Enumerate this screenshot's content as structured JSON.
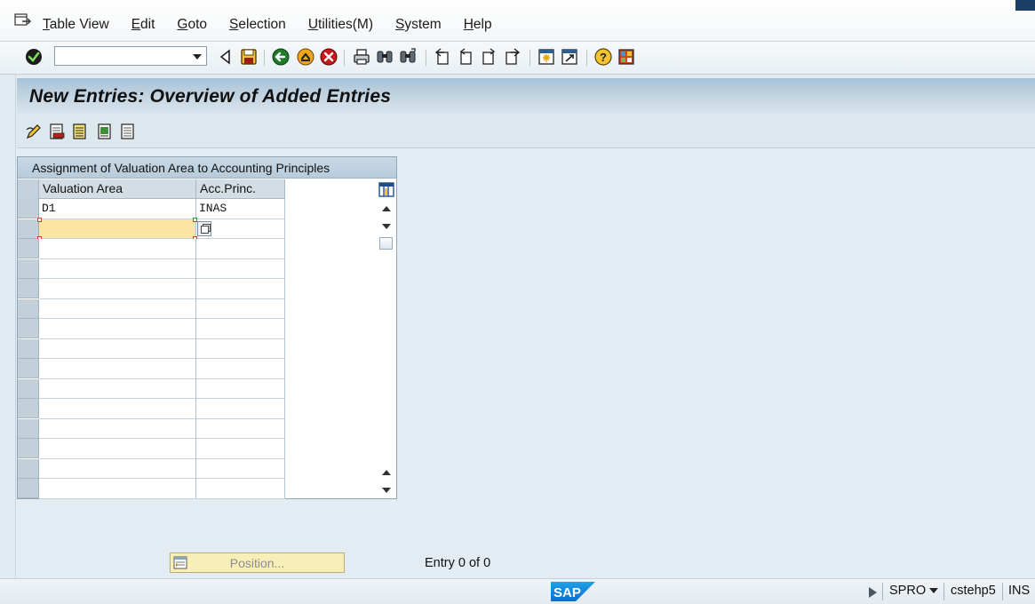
{
  "menubar": {
    "items": [
      "Table View",
      "Edit",
      "Goto",
      "Selection",
      "Utilities(M)",
      "System",
      "Help"
    ]
  },
  "toolbar": {
    "command_value": "",
    "icons": [
      "enter-icon",
      "back-nav-icon",
      "save-icon",
      "back-icon",
      "exit-icon",
      "cancel-icon",
      "print-icon",
      "find-icon",
      "find-next-icon",
      "first-page-icon",
      "previous-page-icon",
      "next-page-icon",
      "last-page-icon",
      "create-session-icon",
      "create-shortcut-icon",
      "help-icon",
      "customize-layout-icon"
    ]
  },
  "title": "New Entries: Overview of Added Entries",
  "app_toolbar": {
    "icons": [
      "change-display-icon",
      "delete-icon",
      "select-all-icon",
      "select-block-icon",
      "deselect-all-icon"
    ]
  },
  "table": {
    "caption": "Assignment of Valuation Area to Accounting Principles",
    "columns": [
      "Valuation Area",
      "Acc.Princ."
    ],
    "rows": [
      {
        "valuation_area": "D1",
        "acc_princ": "INAS"
      },
      {
        "valuation_area": "",
        "acc_princ": ""
      },
      {
        "valuation_area": "",
        "acc_princ": ""
      },
      {
        "valuation_area": "",
        "acc_princ": ""
      },
      {
        "valuation_area": "",
        "acc_princ": ""
      },
      {
        "valuation_area": "",
        "acc_princ": ""
      },
      {
        "valuation_area": "",
        "acc_princ": ""
      },
      {
        "valuation_area": "",
        "acc_princ": ""
      },
      {
        "valuation_area": "",
        "acc_princ": ""
      },
      {
        "valuation_area": "",
        "acc_princ": ""
      },
      {
        "valuation_area": "",
        "acc_princ": ""
      },
      {
        "valuation_area": "",
        "acc_princ": ""
      },
      {
        "valuation_area": "",
        "acc_princ": ""
      },
      {
        "valuation_area": "",
        "acc_princ": ""
      },
      {
        "valuation_area": "",
        "acc_princ": ""
      }
    ]
  },
  "position_button": "Position...",
  "entry_count": "Entry 0 of 0",
  "status": {
    "logo": "SAP",
    "transaction": "SPRO",
    "server": "cstehp5",
    "mode": "INS"
  },
  "colors": {
    "title_band": "#a8c3d8",
    "active_cell": "#fbe5a3",
    "position_button": "#f7efb7",
    "sap_blue": "#0a6ed1"
  }
}
